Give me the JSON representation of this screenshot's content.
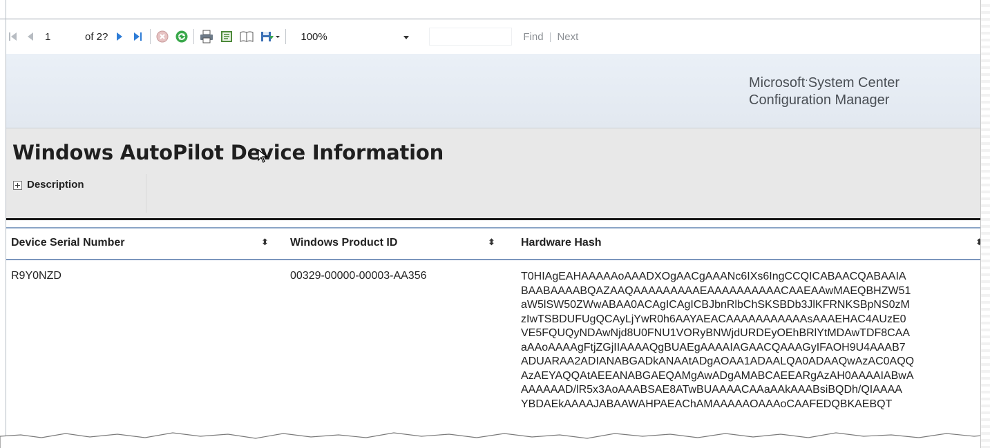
{
  "toolbar": {
    "page_number": "1",
    "page_of": "of 2?",
    "zoom": "100%",
    "search_value": "",
    "find_label": "Find",
    "separator": "|",
    "next_label": "Next"
  },
  "banner": {
    "brand_line1_a": "Microsoft",
    "brand_dot": "·",
    "brand_line1_b": "System Center",
    "brand_line2": "Configuration Manager"
  },
  "report": {
    "title": "Windows AutoPilot Device Information",
    "description_label": "Description"
  },
  "table": {
    "columns": [
      "Device Serial Number",
      "Windows Product ID",
      "Hardware Hash"
    ],
    "rows": [
      {
        "serial": "R9Y0NZD",
        "product_id": "00329-00000-00003-AA356",
        "hash_lines": [
          "T0HIAgEAHAAAAAoAAADXOgAACgAAANc6IXs6IngCCQICABAACQABAAIA",
          "BAABAAAABQAZAAQAAAAAAAAAEAAAAAAAAAACAAEAAwMAEQBHZW51",
          "aW5lSW50ZWwABAA0ACAgICAgICBJbnRlbChSKSBDb3JlKFRNKSBpNS0zM",
          "zIwTSBDUFUgQCAyLjYwR0h6AAYAEACAAAAAAAAAAAsAAAEHAC4AUzE0",
          "VE5FQUQyNDAwNjd8U0FNU1VORyBNWjdURDEyOEhBRlYtMDAwTDF8CAA",
          "aAAoAAAAgFtjZGjIIAAAAQgBUAEgAAAAIAGAACQAAAGyIFAOH9U4AAAB7",
          "ADUARAA2ADIANABGADkANAAtADgAOAA1ADAALQA0ADAAQwAzAC0AQQ",
          "AzAEYAQQAtAEEANABGAEQAMgAwADgAMABCAEEARgAzAH0AAAAIABwA",
          "AAAAAAD/lR5x3AoAAABSAE8ATwBUAAAACAAaAAkAAABsiBQDh/QIAAAA",
          "YBDAEkAAAAJABAAWAHPAEAChAMAAAAAOAAAoCAAFEDQBKAEBQT"
        ]
      }
    ]
  }
}
